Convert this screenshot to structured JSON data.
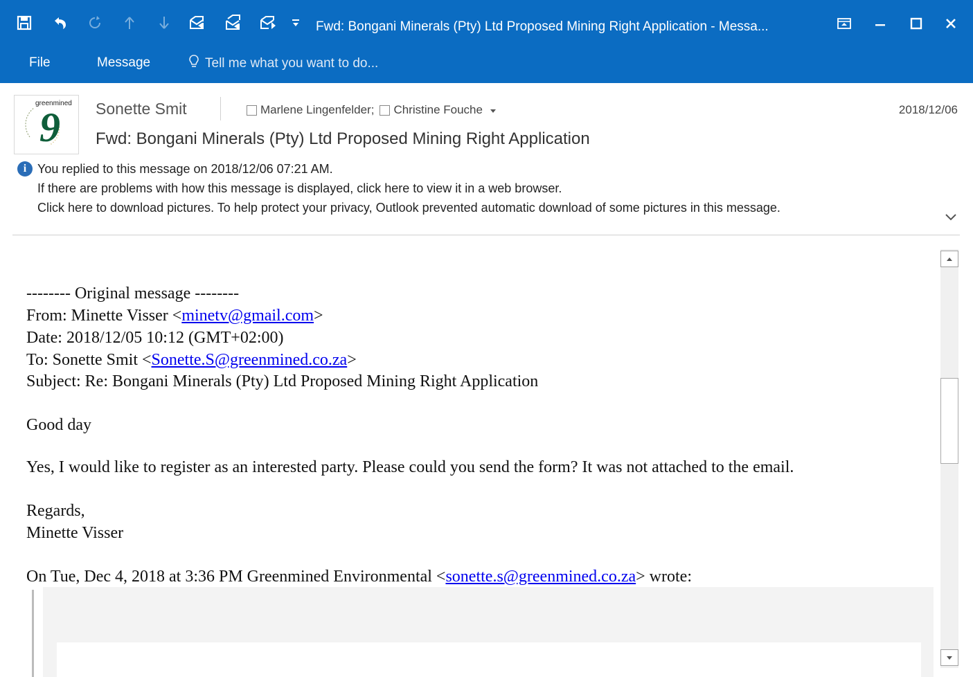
{
  "window": {
    "title": "Fwd: Bongani Minerals (Pty) Ltd Proposed Mining Right Application - Messa...",
    "accent_color": "#0b6cc2"
  },
  "quick_access": [
    {
      "icon": "save-icon"
    },
    {
      "icon": "undo-icon"
    },
    {
      "icon": "redo-icon"
    },
    {
      "icon": "previous-item-icon"
    },
    {
      "icon": "next-item-icon"
    },
    {
      "icon": "reply-icon"
    },
    {
      "icon": "reply-all-icon"
    },
    {
      "icon": "forward-icon"
    },
    {
      "icon": "customize-toolbar-icon"
    }
  ],
  "menu": {
    "file": "File",
    "message": "Message",
    "tell_me_placeholder": "Tell me what you want to do..."
  },
  "header": {
    "sender": "Sonette Smit",
    "recipients": [
      "Marlene Lingenfelder;",
      "Christine Fouche"
    ],
    "date": "2018/12/06",
    "subject": "Fwd: Bongani Minerals (Pty) Ltd Proposed Mining Right Application",
    "avatar_logo_text": "greenmined"
  },
  "info_bar": {
    "replied": "You replied to this message on 2018/12/06 07:21 AM.",
    "browser": "If there are problems with how this message is displayed, click here to view it in a web browser.",
    "pictures": "Click here to download pictures. To help protect your privacy, Outlook prevented automatic download of some pictures in this message."
  },
  "body": {
    "original_marker": "-------- Original message --------",
    "from_label": "From: Minette Visser <",
    "from_email": "minetv@gmail.com",
    "from_end": ">",
    "date_line": "Date: 2018/12/05 10:12 (GMT+02:00)",
    "to_label": "To: Sonette Smit <",
    "to_email": "Sonette.S@greenmined.co.za",
    "to_end": ">",
    "subject_line": "Subject: Re: Bongani Minerals (Pty) Ltd Proposed Mining Right Application",
    "greeting": "Good day",
    "paragraph": "Yes, I would like to register as an interested party. Please could you send the form? It was not attached to the email.",
    "regards": "Regards,",
    "signature": "Minette Visser",
    "wrote_prefix": "On Tue, Dec 4, 2018 at 3:36 PM Greenmined Environmental <",
    "wrote_email": "sonette.s@greenmined.co.za",
    "wrote_suffix": "> wrote:"
  }
}
